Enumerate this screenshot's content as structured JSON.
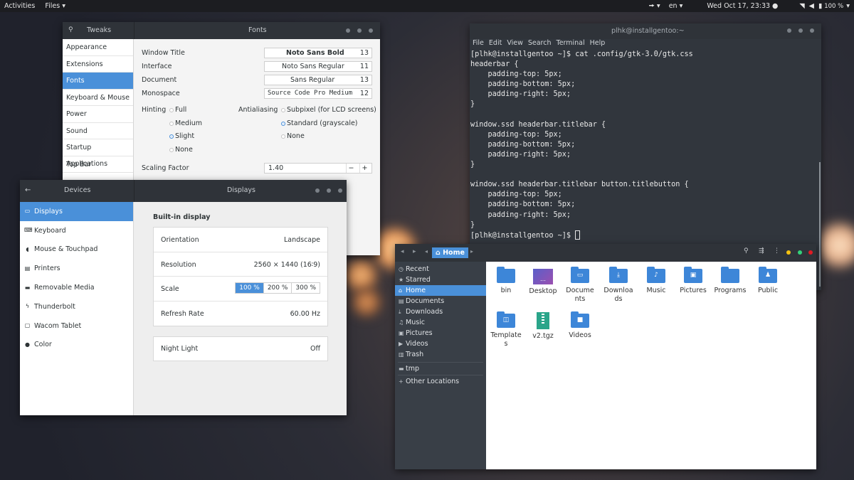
{
  "topbar": {
    "activities": "Activities",
    "app_menu": "Files ▾",
    "input_indicator": "🠚 ▾",
    "lang": "en ▾",
    "clock": "Wed Oct 17, 23:33 ●",
    "battery": "100 %",
    "battery_arrow": "▾"
  },
  "tweaks": {
    "sidebar_title": "Tweaks",
    "title": "Fonts",
    "sidebar": [
      "Appearance",
      "Extensions",
      "Fonts",
      "Keyboard & Mouse",
      "Power",
      "Sound",
      "Startup Applications",
      "Top Bar"
    ],
    "fonts": [
      {
        "label": "Window Title",
        "font": "Noto Sans Bold",
        "size": "13"
      },
      {
        "label": "Interface",
        "font": "Noto Sans Regular",
        "size": "11"
      },
      {
        "label": "Document",
        "font": "Sans Regular",
        "size": "13"
      },
      {
        "label": "Monospace",
        "font": "Source Code Pro Medium",
        "size": "12"
      }
    ],
    "hinting_label": "Hinting",
    "hinting": [
      "Full",
      "Medium",
      "Slight",
      "None"
    ],
    "hinting_selected": "Slight",
    "antialiasing_label": "Antialiasing",
    "antialiasing": [
      "Subpixel (for LCD screens)",
      "Standard (grayscale)",
      "None"
    ],
    "antialiasing_selected": "Standard (grayscale)",
    "scaling_label": "Scaling Factor",
    "scaling_value": "1.40",
    "minus": "−",
    "plus": "+"
  },
  "terminal": {
    "title": "plhk@installgentoo:~",
    "menu": [
      "File",
      "Edit",
      "View",
      "Search",
      "Terminal",
      "Help"
    ],
    "lines": [
      "[plhk@installgentoo ~]$ cat .config/gtk-3.0/gtk.css",
      "headerbar {",
      "    padding-top: 5px;",
      "    padding-bottom: 5px;",
      "    padding-right: 5px;",
      "}",
      "",
      "window.ssd headerbar.titlebar {",
      "    padding-top: 5px;",
      "    padding-bottom: 5px;",
      "    padding-right: 5px;",
      "}",
      "",
      "window.ssd headerbar.titlebar button.titlebutton {",
      "    padding-top: 5px;",
      "    padding-bottom: 5px;",
      "    padding-right: 5px;",
      "}",
      "[plhk@installgentoo ~]$ "
    ]
  },
  "settings": {
    "back": "←",
    "sidebar_title": "Devices",
    "title": "Displays",
    "sidebar": [
      {
        "label": "Displays",
        "icon": "display-icon",
        "glyph": "▭"
      },
      {
        "label": "Keyboard",
        "icon": "keyboard-icon",
        "glyph": "⌨"
      },
      {
        "label": "Mouse & Touchpad",
        "icon": "mouse-icon",
        "glyph": "◖"
      },
      {
        "label": "Printers",
        "icon": "printer-icon",
        "glyph": "▤"
      },
      {
        "label": "Removable Media",
        "icon": "media-icon",
        "glyph": "▬"
      },
      {
        "label": "Thunderbolt",
        "icon": "thunderbolt-icon",
        "glyph": "ϟ"
      },
      {
        "label": "Wacom Tablet",
        "icon": "tablet-icon",
        "glyph": "▢"
      },
      {
        "label": "Color",
        "icon": "color-icon",
        "glyph": "●"
      }
    ],
    "section": "Built-in display",
    "orientation_label": "Orientation",
    "orientation_value": "Landscape",
    "resolution_label": "Resolution",
    "resolution_value": "2560 × 1440 (16∶9)",
    "scale_label": "Scale",
    "scales": [
      "100 %",
      "200 %",
      "300 %"
    ],
    "scale_selected": "100 %",
    "refresh_label": "Refresh Rate",
    "refresh_value": "60.00 Hz",
    "nightlight_label": "Night Light",
    "nightlight_value": "Off"
  },
  "files": {
    "location": "Home",
    "sidebar": [
      {
        "label": "Recent",
        "icon": "clock-icon",
        "glyph": "◷"
      },
      {
        "label": "Starred",
        "icon": "star-icon",
        "glyph": "★"
      },
      {
        "label": "Home",
        "icon": "home-icon",
        "glyph": "⌂"
      },
      {
        "label": "Documents",
        "icon": "documents-icon",
        "glyph": "▤"
      },
      {
        "label": "Downloads",
        "icon": "download-icon",
        "glyph": "⤓"
      },
      {
        "label": "Music",
        "icon": "music-icon",
        "glyph": "♫"
      },
      {
        "label": "Pictures",
        "icon": "pictures-icon",
        "glyph": "▣"
      },
      {
        "label": "Videos",
        "icon": "videos-icon",
        "glyph": "▶"
      },
      {
        "label": "Trash",
        "icon": "trash-icon",
        "glyph": "▥"
      }
    ],
    "tmp": "tmp",
    "other": "Other Locations",
    "items": [
      {
        "label": "bin",
        "glyph": ""
      },
      {
        "label": "Desktop",
        "glyph": "…"
      },
      {
        "label": "Documents",
        "glyph": "▭"
      },
      {
        "label": "Downloads",
        "glyph": "⤓"
      },
      {
        "label": "Music",
        "glyph": "♪"
      },
      {
        "label": "Pictures",
        "glyph": "▣"
      },
      {
        "label": "Programs",
        "glyph": ""
      },
      {
        "label": "Public",
        "glyph": "♟"
      },
      {
        "label": "Templates",
        "glyph": "◫"
      },
      {
        "label": "v2.tgz",
        "glyph": ""
      },
      {
        "label": "Videos",
        "glyph": "■"
      }
    ]
  }
}
